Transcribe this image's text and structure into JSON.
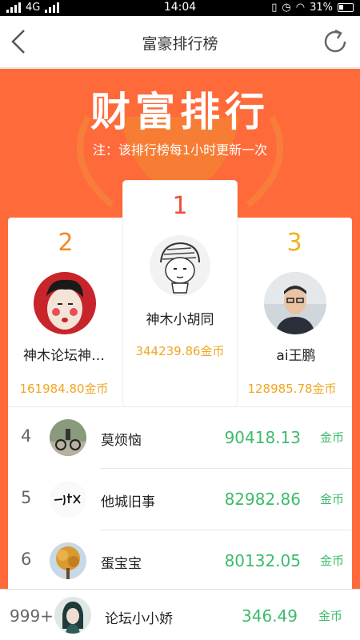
{
  "statusbar": {
    "network": "4G",
    "time": "14:04",
    "battery": "31%"
  },
  "nav": {
    "title": "富豪排行榜",
    "back_icon": "chevron-left-icon",
    "refresh_icon": "refresh-icon"
  },
  "banner": {
    "title": "财富排行",
    "note": "注：该排行榜每1小时更新一次"
  },
  "colors": {
    "banner": "#ff6a3a",
    "rank1": "#ee4f3a",
    "rank2": "#f08a28",
    "rank3": "#f0b020",
    "coins": "#f0a623",
    "score": "#3dbb6a"
  },
  "podium": {
    "first": {
      "rank": "1",
      "name": "神木小胡同",
      "coins": "344239.86金币"
    },
    "second": {
      "rank": "2",
      "name": "神木论坛神…",
      "coins": "161984.80金币"
    },
    "third": {
      "rank": "3",
      "name": "ai王鹏",
      "coins": "128985.78金币"
    }
  },
  "list": [
    {
      "rank": "4",
      "name": "莫烦恼",
      "score": "90418.13",
      "unit": "金币"
    },
    {
      "rank": "5",
      "name": "他城旧事",
      "score": "82982.86",
      "unit": "金币"
    },
    {
      "rank": "6",
      "name": "蛋宝宝",
      "score": "80132.05",
      "unit": "金币"
    }
  ],
  "me": {
    "rank": "999+",
    "name": "论坛小小娇",
    "score": "346.49",
    "unit": "金币"
  }
}
